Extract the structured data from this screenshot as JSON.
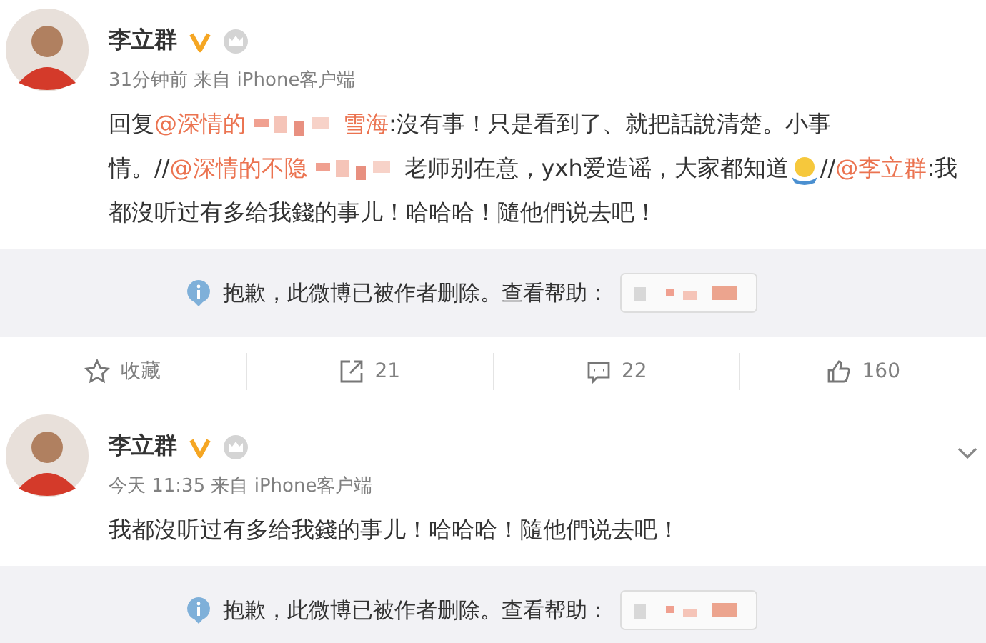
{
  "posts": [
    {
      "author": "李立群",
      "verified": true,
      "member": true,
      "meta": "31分钟前 来自 iPhone客户端",
      "body": [
        {
          "kind": "text",
          "text": "回复"
        },
        {
          "kind": "mention",
          "text": "@深情的"
        },
        {
          "kind": "redaction"
        },
        {
          "kind": "mention",
          "text": "雪海"
        },
        {
          "kind": "text",
          "text": ":沒有事！只是看到了、就把話說清楚。小事情。//"
        },
        {
          "kind": "mention",
          "text": "@深情的不隐"
        },
        {
          "kind": "redaction"
        },
        {
          "kind": "text",
          "text": "老师别在意，yxh爱造谣，大家都知道"
        },
        {
          "kind": "emoji"
        },
        {
          "kind": "text",
          "text": "//"
        },
        {
          "kind": "mention",
          "text": "@李立群"
        },
        {
          "kind": "text",
          "text": ":我都沒听过有多给我錢的事儿！哈哈哈！隨他們说去吧！"
        }
      ],
      "notice": {
        "text": "抱歉，此微博已被作者删除。查看帮助："
      },
      "actions": [
        {
          "kind": "favorite",
          "label": "收藏"
        },
        {
          "kind": "repost",
          "label": "21"
        },
        {
          "kind": "comment",
          "label": "22"
        },
        {
          "kind": "like",
          "label": "160"
        }
      ]
    },
    {
      "author": "李立群",
      "verified": true,
      "member": true,
      "meta": "今天 11:35 来自 iPhone客户端",
      "menu": true,
      "body": [
        {
          "kind": "text",
          "text": "我都沒听过有多给我錢的事儿！哈哈哈！隨他們说去吧！"
        }
      ],
      "notice": {
        "text": "抱歉，此微博已被作者删除。查看帮助："
      }
    }
  ]
}
